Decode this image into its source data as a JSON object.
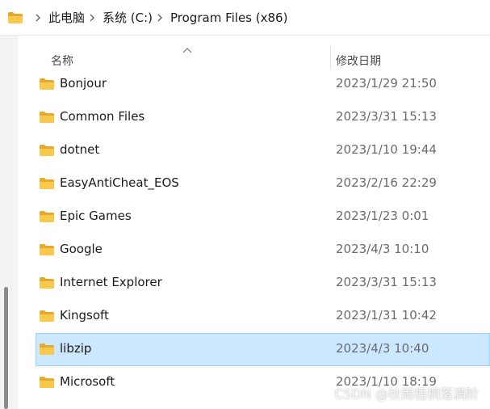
{
  "address_bar": {
    "crumbs": [
      "此电脑",
      "系统 (C:)",
      "Program Files (x86)"
    ]
  },
  "columns": {
    "name": "名称",
    "date_modified": "修改日期"
  },
  "files": [
    {
      "name": "Bonjour",
      "date": "2023/1/29 21:50"
    },
    {
      "name": "Common Files",
      "date": "2023/3/31 15:13"
    },
    {
      "name": "dotnet",
      "date": "2023/1/10 19:44"
    },
    {
      "name": "EasyAntiCheat_EOS",
      "date": "2023/2/16 22:29"
    },
    {
      "name": "Epic Games",
      "date": "2023/1/23 0:01"
    },
    {
      "name": "Google",
      "date": "2023/4/3 10:10"
    },
    {
      "name": "Internet Explorer",
      "date": "2023/3/31 15:13"
    },
    {
      "name": "Kingsoft",
      "date": "2023/1/31 10:42"
    },
    {
      "name": "libzip",
      "date": "2023/4/3 10:40"
    },
    {
      "name": "Microsoft",
      "date": "2023/1/10 18:19"
    }
  ],
  "selected_item": "libzip",
  "watermark": "CSDN @秋雨梧桐落满阶",
  "icons": {
    "folder": "folder-icon",
    "breadcrumb_separator": "chevron-right-icon",
    "sort": "sort-ascending-icon"
  },
  "colors": {
    "folder_body": "#f8c94a",
    "folder_back": "#e8a92a",
    "selection_bg": "#cce8ff",
    "selection_border": "#99d1ff"
  }
}
